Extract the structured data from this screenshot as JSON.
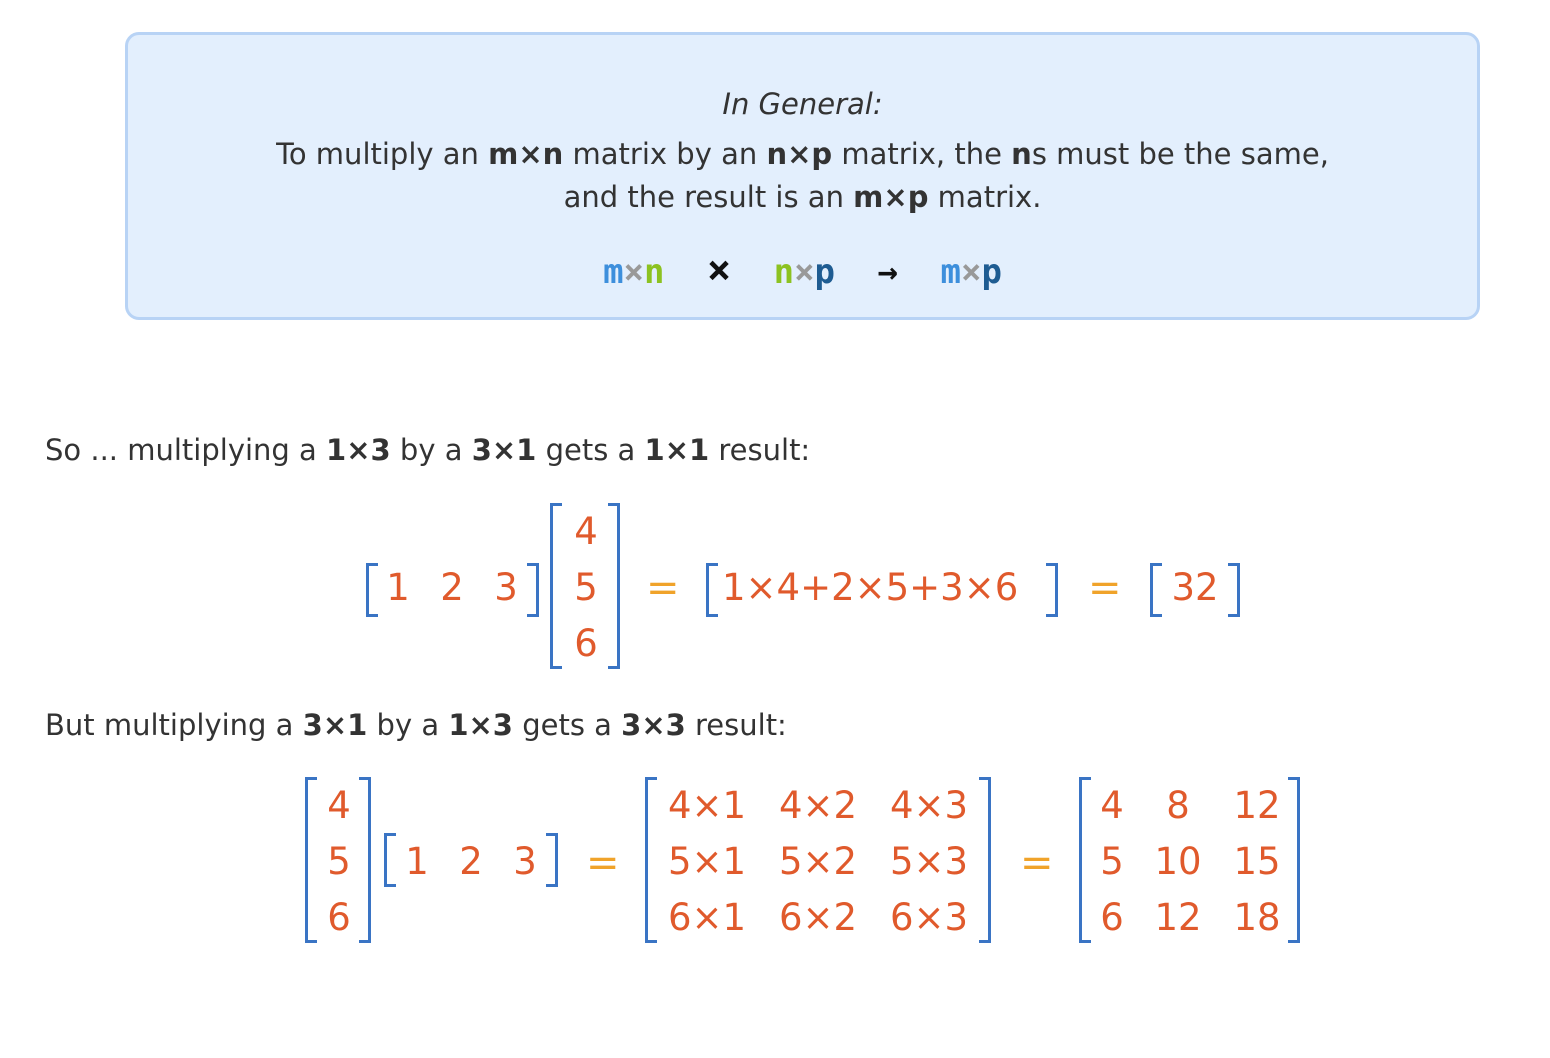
{
  "box": {
    "title": "In General:",
    "line1_parts": [
      "To multiply an ",
      "m×n",
      " matrix by an ",
      "n×p",
      " matrix, the ",
      "n",
      "s must be the same,"
    ],
    "line2_parts": [
      "and the result is an ",
      "m×p",
      " matrix."
    ],
    "formula": {
      "m1": "m",
      "x1": "×",
      "n1": "n",
      "times": "×",
      "n2": "n",
      "x2": "×",
      "p1": "p",
      "arrow": "→",
      "m2": "m",
      "x3": "×",
      "p2": "p"
    }
  },
  "example1": {
    "sentence_parts": [
      "So ... multiplying a ",
      "1×3",
      " by a ",
      "3×1",
      " gets a ",
      "1×1",
      " result:"
    ],
    "row": [
      "1",
      "2",
      "3"
    ],
    "col": [
      "4",
      "5",
      "6"
    ],
    "eq": "=",
    "expansion": "1×4+2×5+3×6",
    "result": "32"
  },
  "example2": {
    "sentence_parts": [
      "But multiplying a ",
      "3×1",
      " by a ",
      "1×3",
      " gets a ",
      "3×3",
      " result:"
    ],
    "col": [
      "4",
      "5",
      "6"
    ],
    "row": [
      "1",
      "2",
      "3"
    ],
    "eq": "=",
    "products": [
      [
        "4×1",
        "4×2",
        "4×3"
      ],
      [
        "5×1",
        "5×2",
        "5×3"
      ],
      [
        "6×1",
        "6×2",
        "6×3"
      ]
    ],
    "results": [
      [
        "4",
        "8",
        "12"
      ],
      [
        "5",
        "10",
        "15"
      ],
      [
        "6",
        "12",
        "18"
      ]
    ]
  },
  "colors": {
    "box_bg": "#e3effd",
    "box_border": "#b8d3f5",
    "number": "#e05a2c",
    "bracket": "#3a74c4",
    "equals": "#f0a32a",
    "m": "#3d8fdc",
    "n": "#8cc221",
    "p": "#1e5c92"
  }
}
